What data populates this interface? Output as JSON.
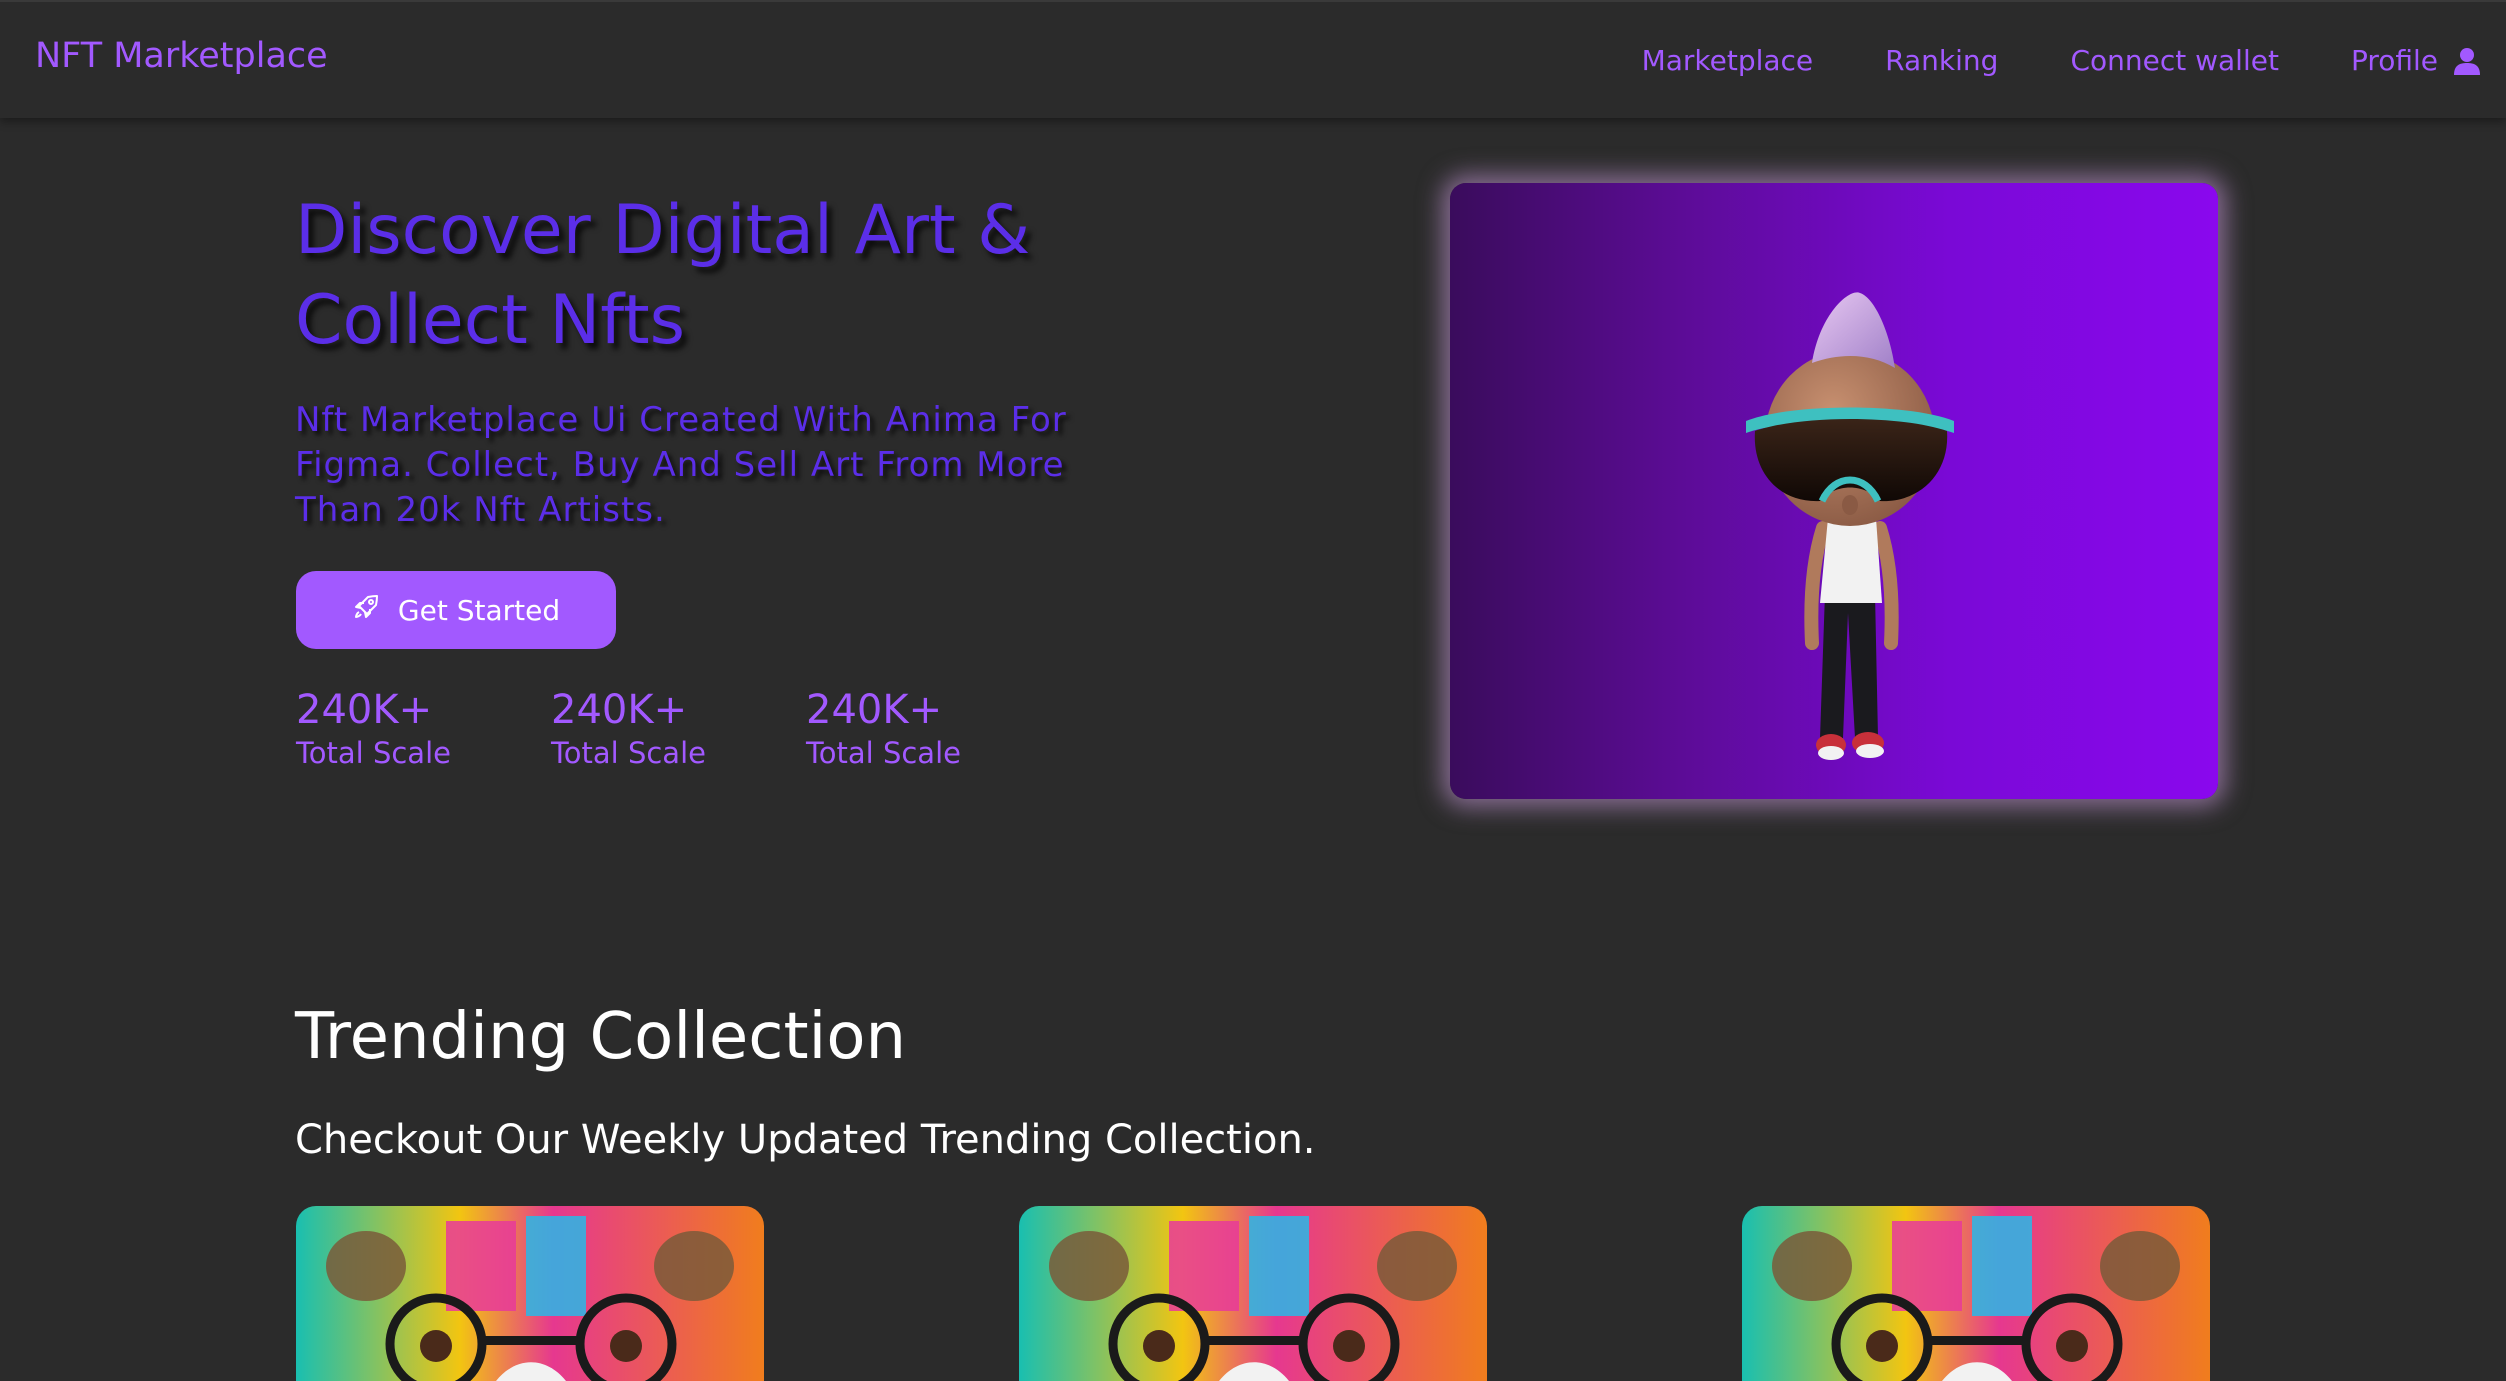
{
  "brand": "NFT Marketplace",
  "nav": {
    "links": [
      "Marketplace",
      "Ranking",
      "Connect wallet"
    ],
    "profile_label": "Profile"
  },
  "hero": {
    "title": "Discover Digital Art & Collect Nfts",
    "subtitle": "Nft Marketplace Ui Created With Anima For Figma. Collect, Buy And Sell Art From More Than 20k Nft Artists.",
    "cta_label": "Get Started",
    "stats": [
      {
        "value": "240K+",
        "label": "Total Scale"
      },
      {
        "value": "240K+",
        "label": "Total Scale"
      },
      {
        "value": "240K+",
        "label": "Total Scale"
      }
    ]
  },
  "trending": {
    "title": "Trending Collection",
    "subtitle": "Checkout Our Weekly Updated Trending Collection."
  },
  "colors": {
    "background": "#2b2b2b",
    "accent": "#a259ff",
    "hero_text": "#5b2ee8",
    "white": "#ffffff"
  },
  "icons": {
    "cta": "rocket-icon",
    "profile": "user-icon"
  }
}
